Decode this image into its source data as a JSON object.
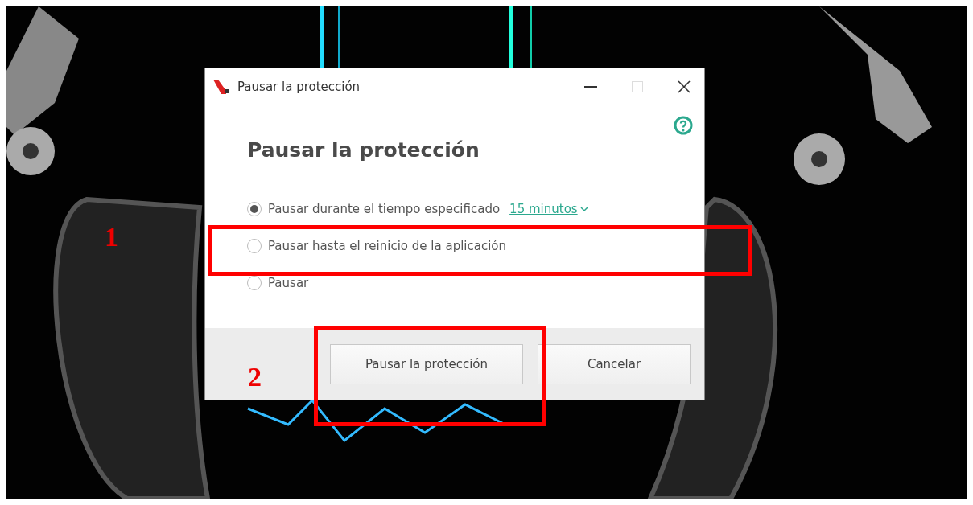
{
  "window": {
    "title": "Pausar la protección"
  },
  "heading": "Pausar la protección",
  "options": [
    {
      "label": "Pausar durante el tiempo especificado",
      "link": "15 minutos",
      "selected": true
    },
    {
      "label": "Pausar hasta el reinicio de la aplicación",
      "selected": false
    },
    {
      "label": "Pausar",
      "selected": false
    }
  ],
  "buttons": [
    {
      "label": "Pausar la protección"
    },
    {
      "label": "Cancelar"
    }
  ],
  "annotations": [
    {
      "label": "1"
    },
    {
      "label": "2"
    }
  ]
}
